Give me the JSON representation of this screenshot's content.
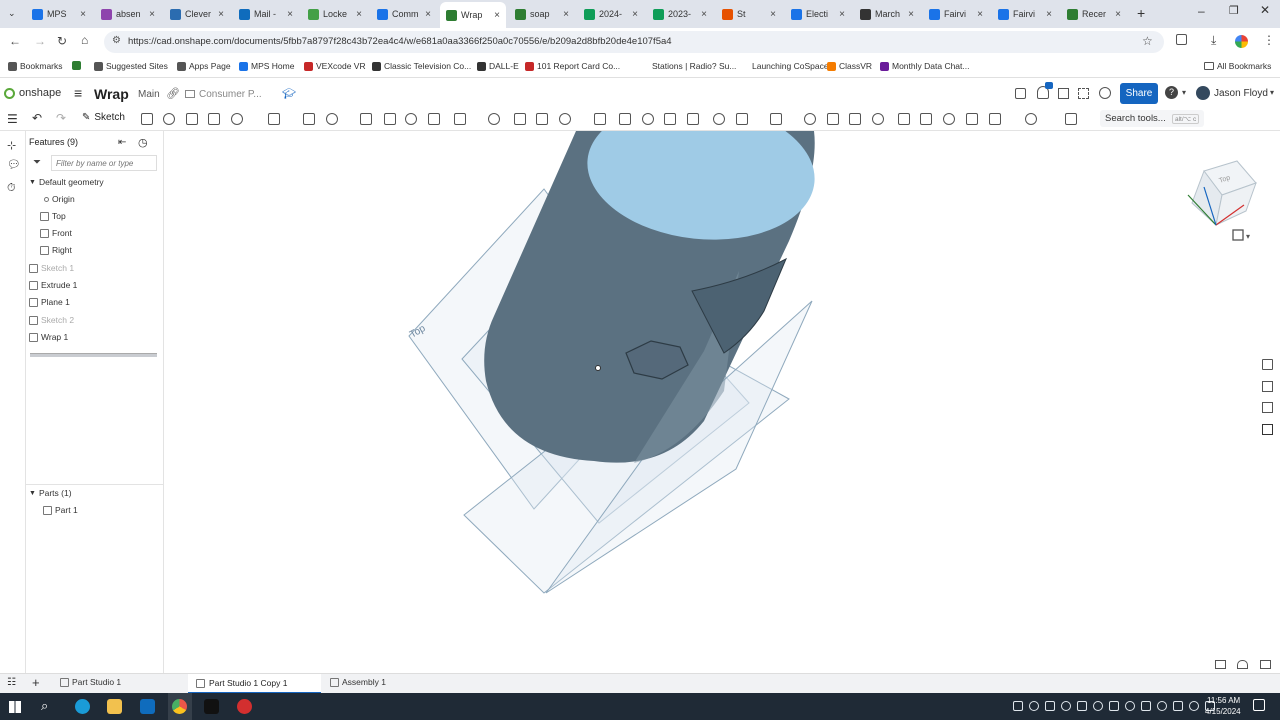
{
  "browser": {
    "tabs": [
      {
        "label": "MPS",
        "color": "#1a73e8"
      },
      {
        "label": "absen",
        "color": "#8e44ad"
      },
      {
        "label": "Clever",
        "color": "#2b6cb0"
      },
      {
        "label": "Mail -",
        "color": "#0f6cbd"
      },
      {
        "label": "Locke",
        "color": "#43a047"
      },
      {
        "label": "Comm",
        "color": "#1a73e8"
      },
      {
        "label": "Wrap",
        "color": "#2e7d32"
      },
      {
        "label": "soap",
        "color": "#2e7d32"
      },
      {
        "label": "2024-",
        "color": "#0f9d58"
      },
      {
        "label": "2023-",
        "color": "#0f9d58"
      },
      {
        "label": "St",
        "color": "#e65100"
      },
      {
        "label": "Electi",
        "color": "#1a73e8"
      },
      {
        "label": "March",
        "color": "#333333"
      },
      {
        "label": "Fairvi",
        "color": "#1a73e8"
      },
      {
        "label": "Fairvi",
        "color": "#1a73e8"
      },
      {
        "label": "Recer",
        "color": "#2e7d32"
      }
    ],
    "url": "https://cad.onshape.com/documents/5fbb7a8797f28c43b72ea4c4/w/e681a0aa3366f250a0c70556/e/b209a2d8bfb20de4e107f5a4",
    "bookmarks": [
      {
        "label": "Bookmarks",
        "color": "#555555"
      },
      {
        "label": "",
        "color": "#2e7d32"
      },
      {
        "label": "Suggested Sites",
        "color": "#555555"
      },
      {
        "label": "Apps Page",
        "color": "#555555"
      },
      {
        "label": "MPS Home",
        "color": "#1a73e8"
      },
      {
        "label": "VEXcode VR",
        "color": "#c62828"
      },
      {
        "label": "Classic Television Co...",
        "color": "#333333"
      },
      {
        "label": "DALL-E",
        "color": "#333333"
      },
      {
        "label": "101 Report Card Co...",
        "color": "#c62828"
      },
      {
        "label": "Stations | Radio? Su...",
        "color": "#ffffff"
      },
      {
        "label": "Launching CoSpace...",
        "color": "#ffffff"
      },
      {
        "label": "ClassVR",
        "color": "#f57c00"
      },
      {
        "label": "Monthly Data Chat...",
        "color": "#6a1b9a"
      }
    ],
    "all_bookmarks": "All Bookmarks"
  },
  "app": {
    "logo": "onshape",
    "doc_title": "Wrap",
    "branch": "Main",
    "folder": "Consumer P...",
    "share_label": "Share",
    "user_name": "Jason Floyd",
    "sketch_label": "Sketch",
    "search_tools": "Search tools...",
    "search_shortcut": "alt/⌥ c",
    "accent": "#1565c0"
  },
  "features": {
    "header": "Features (9)",
    "filter_placeholder": "Filter by name or type",
    "default_geometry": "Default geometry",
    "items": [
      {
        "label": "Origin",
        "dim": false
      },
      {
        "label": "Top",
        "dim": false
      },
      {
        "label": "Front",
        "dim": false
      },
      {
        "label": "Right",
        "dim": false
      },
      {
        "label": "Sketch 1",
        "dim": true
      },
      {
        "label": "Extrude 1",
        "dim": false
      },
      {
        "label": "Plane 1",
        "dim": false
      },
      {
        "label": "Sketch 2",
        "dim": true
      },
      {
        "label": "Wrap 1",
        "dim": false
      }
    ],
    "parts_header": "Parts (1)",
    "parts": [
      "Part 1"
    ]
  },
  "viewport": {
    "plane_label": "Top",
    "viewcube_face": "Top",
    "body_color": "#5b7181",
    "cap_color": "#9fcbe6"
  },
  "bottom_tabs": [
    "Part Studio 1",
    "Part Studio 1 Copy 1",
    "Assembly 1"
  ],
  "taskbar": {
    "time": "11:56 AM",
    "date": "4/15/2024"
  }
}
